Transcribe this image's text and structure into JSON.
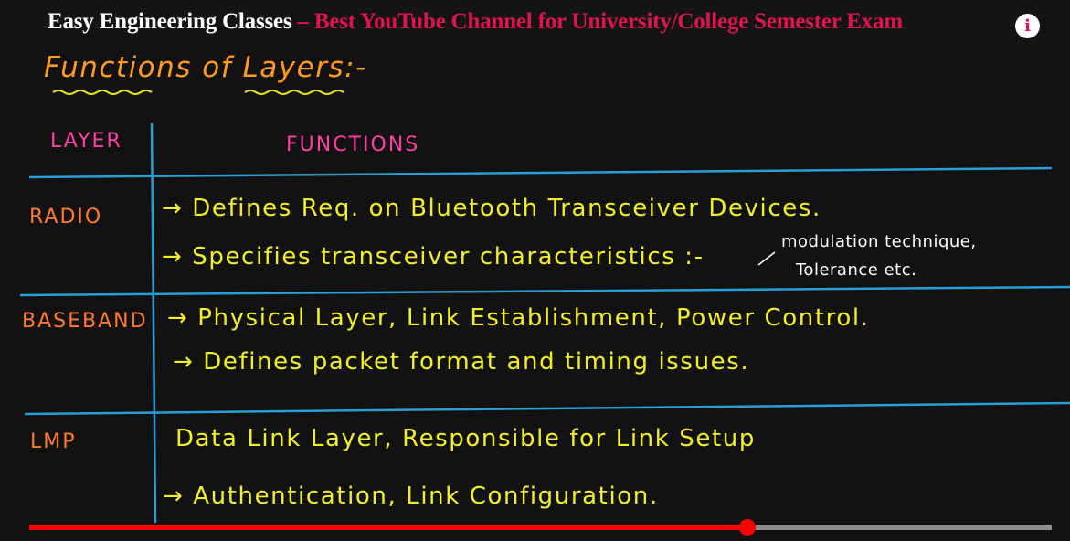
{
  "header": {
    "brand": "Easy Engineering Classes",
    "tagline": " – Best YouTube Channel for University/College Semester Exam",
    "info_icon": "i"
  },
  "board": {
    "title": "Functions of Layers:-",
    "columns": [
      "LAYER",
      "FUNCTIONS"
    ],
    "rows": [
      {
        "layer": "RADIO",
        "functions": [
          "→ Defines Req. on Bluetooth Transceiver Devices.",
          "→ Specifies transceiver characteristics :-"
        ],
        "note": [
          "modulation technique,",
          "Tolerance etc."
        ]
      },
      {
        "layer": "BASEBAND",
        "functions": [
          "→ Physical Layer, Link Establishment, Power Control.",
          "→ Defines packet format and timing issues."
        ]
      },
      {
        "layer": "LMP",
        "functions": [
          "Data Link Layer, Responsible for Link Setup",
          "→ Authentication, Link Configuration."
        ]
      }
    ]
  },
  "player": {
    "progress": 0.702,
    "colors": {
      "played": "#ff0000",
      "track": "#8c8c8c"
    }
  },
  "colors": {
    "title": "#ff9a1f",
    "column_heads": "#ff3ea8",
    "layers": "#ff7a2e",
    "functions": "#f4ee2a",
    "grid": "#2a9fd6",
    "tagline": "#e0144d"
  }
}
